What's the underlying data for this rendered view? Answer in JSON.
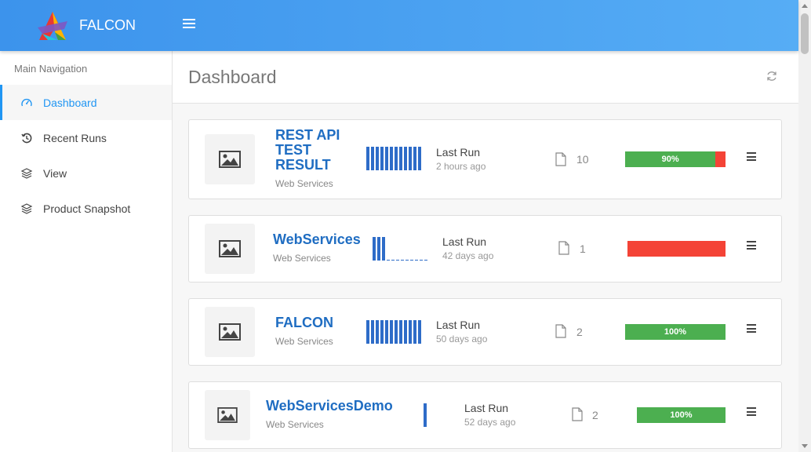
{
  "app": {
    "name": "FALCON"
  },
  "sidebar": {
    "heading": "Main Navigation",
    "items": [
      {
        "label": "Dashboard",
        "icon": "gauge-icon",
        "active": true
      },
      {
        "label": "Recent Runs",
        "icon": "history-icon"
      },
      {
        "label": "View",
        "icon": "layers-icon"
      },
      {
        "label": "Product Snapshot",
        "icon": "layers-icon"
      }
    ]
  },
  "page": {
    "title": "Dashboard"
  },
  "projects": [
    {
      "title_lines": [
        "REST API",
        "TEST",
        "RESULT"
      ],
      "subtitle": "Web Services",
      "last_run_label": "Last Run",
      "last_run_time": "2 hours ago",
      "file_count": "10",
      "pass_pct": 90,
      "pass_label": "90%",
      "spark": [
        1,
        1,
        1,
        1,
        1,
        1,
        1,
        1,
        1,
        1,
        1,
        1
      ]
    },
    {
      "title_lines": [
        "WebServices"
      ],
      "subtitle": "Web Services",
      "last_run_label": "Last Run",
      "last_run_time": "42 days ago",
      "file_count": "1",
      "pass_pct": 0,
      "pass_label": "",
      "spark": [
        1,
        1,
        1,
        0,
        0,
        0,
        0,
        0,
        0,
        0,
        0,
        0
      ]
    },
    {
      "title_lines": [
        "FALCON"
      ],
      "subtitle": "Web Services",
      "last_run_label": "Last Run",
      "last_run_time": "50 days ago",
      "file_count": "2",
      "pass_pct": 100,
      "pass_label": "100%",
      "spark": [
        1,
        1,
        1,
        1,
        1,
        1,
        1,
        1,
        1,
        1,
        1,
        1
      ]
    },
    {
      "title_lines": [
        "WebServicesDemo"
      ],
      "subtitle": "Web Services",
      "last_run_label": "Last Run",
      "last_run_time": "52 days ago",
      "file_count": "2",
      "pass_pct": 100,
      "pass_label": "100%",
      "spark": [
        1
      ]
    }
  ],
  "colors": {
    "accent": "#2196f3",
    "topbar": "#4aa3f2",
    "pass": "#4caf50",
    "fail": "#f44336",
    "title": "#1f6dc2",
    "spark": "#2e6cc8"
  }
}
